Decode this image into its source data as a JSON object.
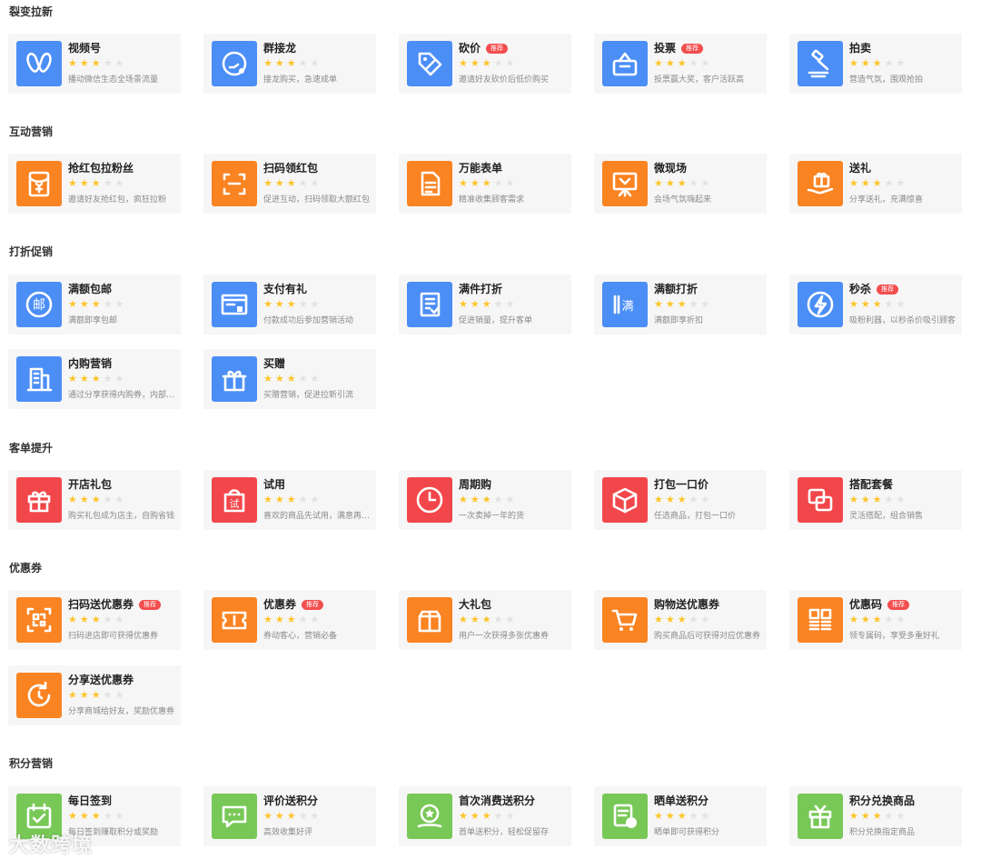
{
  "colors": {
    "blue": "#4b8ef6",
    "orange": "#fa8322",
    "red": "#f2474a",
    "green": "#78c857",
    "badge": "#f34e4e",
    "star": "#fdc52b",
    "card_bg": "#f6f6f6"
  },
  "sections": [
    {
      "title": "裂变拉新",
      "color": "#4b8ef6",
      "items": [
        {
          "title": "视频号",
          "desc": "播动微信生态全场景流量",
          "badge": "",
          "stars": 3,
          "icon": "channels-icon"
        },
        {
          "title": "群接龙",
          "desc": "接龙购买，急速成单",
          "badge": "",
          "stars": 3,
          "icon": "relay-icon"
        },
        {
          "title": "砍价",
          "desc": "邀请好友砍价后低价购买",
          "badge": "推荐",
          "stars": 3,
          "icon": "price-tag-icon"
        },
        {
          "title": "投票",
          "desc": "投票赢大奖，客户活跃高",
          "badge": "推荐",
          "stars": 3,
          "icon": "ballot-box-icon"
        },
        {
          "title": "拍卖",
          "desc": "营造气氛，围观抢拍",
          "badge": "",
          "stars": 3,
          "icon": "gavel-icon"
        }
      ]
    },
    {
      "title": "互动营销",
      "color": "#fa8322",
      "items": [
        {
          "title": "抢红包拉粉丝",
          "desc": "邀请好友抢红包，疯狂拉粉",
          "badge": "",
          "stars": 3,
          "icon": "red-envelope-icon"
        },
        {
          "title": "扫码领红包",
          "desc": "促进互动，扫码领取大额红包",
          "badge": "",
          "stars": 3,
          "icon": "scan-icon"
        },
        {
          "title": "万能表单",
          "desc": "精准收集顾客需求",
          "badge": "",
          "stars": 3,
          "icon": "form-icon"
        },
        {
          "title": "微现场",
          "desc": "会场气氛嗨起来",
          "badge": "",
          "stars": 3,
          "icon": "easel-icon"
        },
        {
          "title": "送礼",
          "desc": "分享送礼，充满惊喜",
          "badge": "",
          "stars": 3,
          "icon": "gift-hand-icon"
        }
      ]
    },
    {
      "title": "打折促销",
      "color": "#4b8ef6",
      "items": [
        {
          "title": "满额包邮",
          "desc": "满额即享包邮",
          "badge": "",
          "stars": 3,
          "icon": "post-icon"
        },
        {
          "title": "支付有礼",
          "desc": "付款成功后参加营销活动",
          "badge": "",
          "stars": 3,
          "icon": "payment-window-icon"
        },
        {
          "title": "满件打折",
          "desc": "促进销量，提升客单",
          "badge": "",
          "stars": 3,
          "icon": "checklist-icon"
        },
        {
          "title": "满额打折",
          "desc": "满额即享折扣",
          "badge": "",
          "stars": 3,
          "icon": "full-discount-icon"
        },
        {
          "title": "秒杀",
          "desc": "吸粉利器，以秒杀价吸引顾客",
          "badge": "推荐",
          "stars": 3,
          "icon": "lightning-icon"
        },
        {
          "title": "内购营销",
          "desc": "通过分享获得内购券，内部优惠",
          "badge": "",
          "stars": 3,
          "icon": "building-icon"
        },
        {
          "title": "买赠",
          "desc": "买赠营销，促进拉新引流",
          "badge": "",
          "stars": 3,
          "icon": "gift-box-icon"
        }
      ]
    },
    {
      "title": "客单提升",
      "color": "#f2474a",
      "items": [
        {
          "title": "开店礼包",
          "desc": "购买礼包成为店主，自购省钱",
          "badge": "",
          "stars": 3,
          "icon": "gift-icon"
        },
        {
          "title": "试用",
          "desc": "喜欢的商品先试用，满意再购买",
          "badge": "",
          "stars": 3,
          "icon": "trial-bag-icon"
        },
        {
          "title": "周期购",
          "desc": "一次卖掉一年的货",
          "badge": "",
          "stars": 3,
          "icon": "clock-icon"
        },
        {
          "title": "打包一口价",
          "desc": "任选商品，打包一口价",
          "badge": "",
          "stars": 3,
          "icon": "package-icon"
        },
        {
          "title": "搭配套餐",
          "desc": "灵活搭配，组合销售",
          "badge": "",
          "stars": 3,
          "icon": "combo-icon"
        }
      ]
    },
    {
      "title": "优惠券",
      "color": "#fa8322",
      "items": [
        {
          "title": "扫码送优惠券",
          "desc": "扫码进店即可获得优惠券",
          "badge": "推荐",
          "stars": 3,
          "icon": "qr-scan-icon"
        },
        {
          "title": "优惠券",
          "desc": "券动客心，营销必备",
          "badge": "推荐",
          "stars": 3,
          "icon": "ticket-icon"
        },
        {
          "title": "大礼包",
          "desc": "用户一次获得多张优惠券",
          "badge": "",
          "stars": 3,
          "icon": "gift-pack-icon"
        },
        {
          "title": "购物送优惠券",
          "desc": "购买商品后可获得对应优惠券",
          "badge": "",
          "stars": 3,
          "icon": "cart-icon"
        },
        {
          "title": "优惠码",
          "desc": "领专属码，享受多重好礼",
          "badge": "推荐",
          "stars": 3,
          "icon": "code-grid-icon"
        },
        {
          "title": "分享送优惠券",
          "desc": "分享商城给好友，奖励优惠券",
          "badge": "",
          "stars": 3,
          "icon": "share-refresh-icon"
        }
      ]
    },
    {
      "title": "积分营销",
      "color": "#78c857",
      "items": [
        {
          "title": "每日签到",
          "desc": "每日签到赚取积分或奖励",
          "badge": "",
          "stars": 3,
          "icon": "calendar-check-icon"
        },
        {
          "title": "评价送积分",
          "desc": "高效收集好评",
          "badge": "",
          "stars": 3,
          "icon": "comment-icon"
        },
        {
          "title": "首次消费送积分",
          "desc": "首单送积分，轻松促留存",
          "badge": "",
          "stars": 3,
          "icon": "star-coin-icon"
        },
        {
          "title": "晒单送积分",
          "desc": "晒单即可获得积分",
          "badge": "",
          "stars": 3,
          "icon": "share-order-icon"
        },
        {
          "title": "积分兑换商品",
          "desc": "积分兑换指定商品",
          "badge": "",
          "stars": 3,
          "icon": "exchange-gift-icon"
        }
      ]
    }
  ],
  "watermark": "大数跨境"
}
